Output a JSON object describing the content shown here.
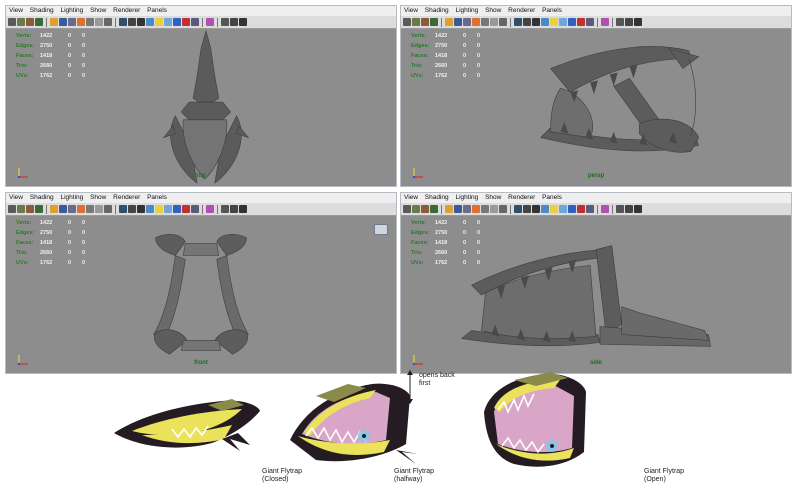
{
  "menu": [
    "View",
    "Shading",
    "Lighting",
    "Show",
    "Renderer",
    "Panels"
  ],
  "hud": {
    "labels": [
      "Verts:",
      "Edges:",
      "Faces:",
      "Tris:",
      "UVs:"
    ],
    "values": [
      "1422",
      "2750",
      "1418",
      "2660",
      "1762"
    ],
    "zero": "0"
  },
  "viewports": [
    {
      "camera": "top"
    },
    {
      "camera": "persp"
    },
    {
      "camera": "front"
    },
    {
      "camera": "side"
    }
  ],
  "annotation": {
    "line1": "opens back",
    "line2": "first"
  },
  "flytraps": [
    {
      "name": "Giant Flytrap",
      "state": "(Closed)"
    },
    {
      "name": "Giant Flytrap",
      "state": "(halfway)"
    },
    {
      "name": "Giant Flytrap",
      "state": "(Open)"
    }
  ],
  "colors": {
    "viewport_bg": "#8d8d8d",
    "hud_label": "#2a7a2a",
    "camera_label": "#1f6b1f",
    "model_gray": "#5e5e5e",
    "flytrap_dark": "#241c22",
    "flytrap_yellow": "#e9e25a",
    "flytrap_pink": "#d9a6c8",
    "flytrap_olive": "#8a8a4a"
  },
  "icons": [
    "select-tool-icon",
    "camera-icon",
    "grid-icon",
    "wireframe-icon",
    "shaded-icon",
    "light-icon",
    "render-icon"
  ]
}
